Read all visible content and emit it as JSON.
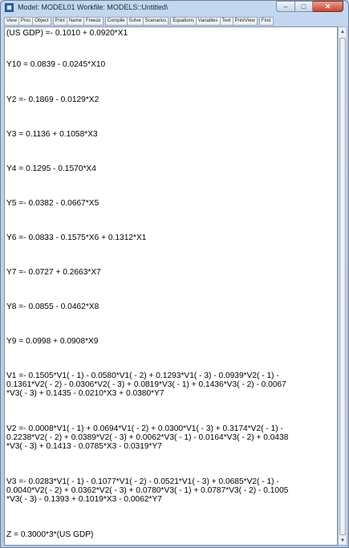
{
  "window": {
    "title": "Model: MODEL01   Workfile: MODELS::Untitled\\",
    "buttons": {
      "minimize": "–",
      "maximize": "□",
      "close": "✕"
    }
  },
  "toolbar": {
    "buttons": [
      "View",
      "Proc",
      "Object",
      "Print",
      "Name",
      "Freeze",
      "Compile",
      "Solve",
      "Scenarios",
      "Equations",
      "Variables",
      "Text",
      "PrintView",
      "Find"
    ]
  },
  "equations": [
    "(US GDP) =- 0.1010 + 0.0920*X1",
    "Y10 = 0.0839 - 0.0245*X10",
    "Y2 =- 0.1869 - 0.0129*X2",
    "Y3 = 0.1136 + 0.1058*X3",
    "Y4 = 0.1295 - 0.1570*X4",
    "Y5 =- 0.0382 - 0.0667*X5",
    "Y6 =- 0.0833 - 0.1575*X6 + 0.1312*X1",
    "Y7 =- 0.0727 + 0.2663*X7",
    "Y8 =- 0.0855 - 0.0462*X8",
    "Y9 = 0.0998 + 0.0908*X9",
    "V1 =- 0.1505*V1( - 1) - 0.0580*V1( - 2) + 0.1293*V1( - 3) - 0.0939*V2( - 1) -\n0.1361*V2( - 2) - 0.0306*V2( - 3) + 0.0819*V3( - 1) + 0.1436*V3( - 2) - 0.0067\n*V3( - 3) + 0.1435 - 0.0210*X3 + 0.0380*Y7",
    "V2 =- 0.0008*V1( - 1) + 0.0694*V1( - 2) + 0.0300*V1( - 3) + 0.3174*V2( - 1) -\n0.2238*V2( - 2) + 0.0389*V2( - 3) + 0.0062*V3( - 1) - 0.0164*V3( - 2) + 0.0438\n*V3( - 3) + 0.1413 - 0.0785*X3 - 0.0319*Y7",
    "V3 =- 0.0283*V1( - 1) - 0.1077*V1( - 2) - 0.0521*V1( - 3) + 0.0685*V2( - 1) -\n0.0040*V2( - 2) + 0.0362*V2( - 3) + 0.0780*V3( - 1) + 0.0787*V3( - 2) - 0.1005\n*V3( - 3) - 0.1393 + 0.1019*X3 - 0.0062*Y7",
    "Z = 0.3000*3*(US GDP)"
  ],
  "scrollbar": {
    "up": "▲",
    "down": "▼"
  }
}
